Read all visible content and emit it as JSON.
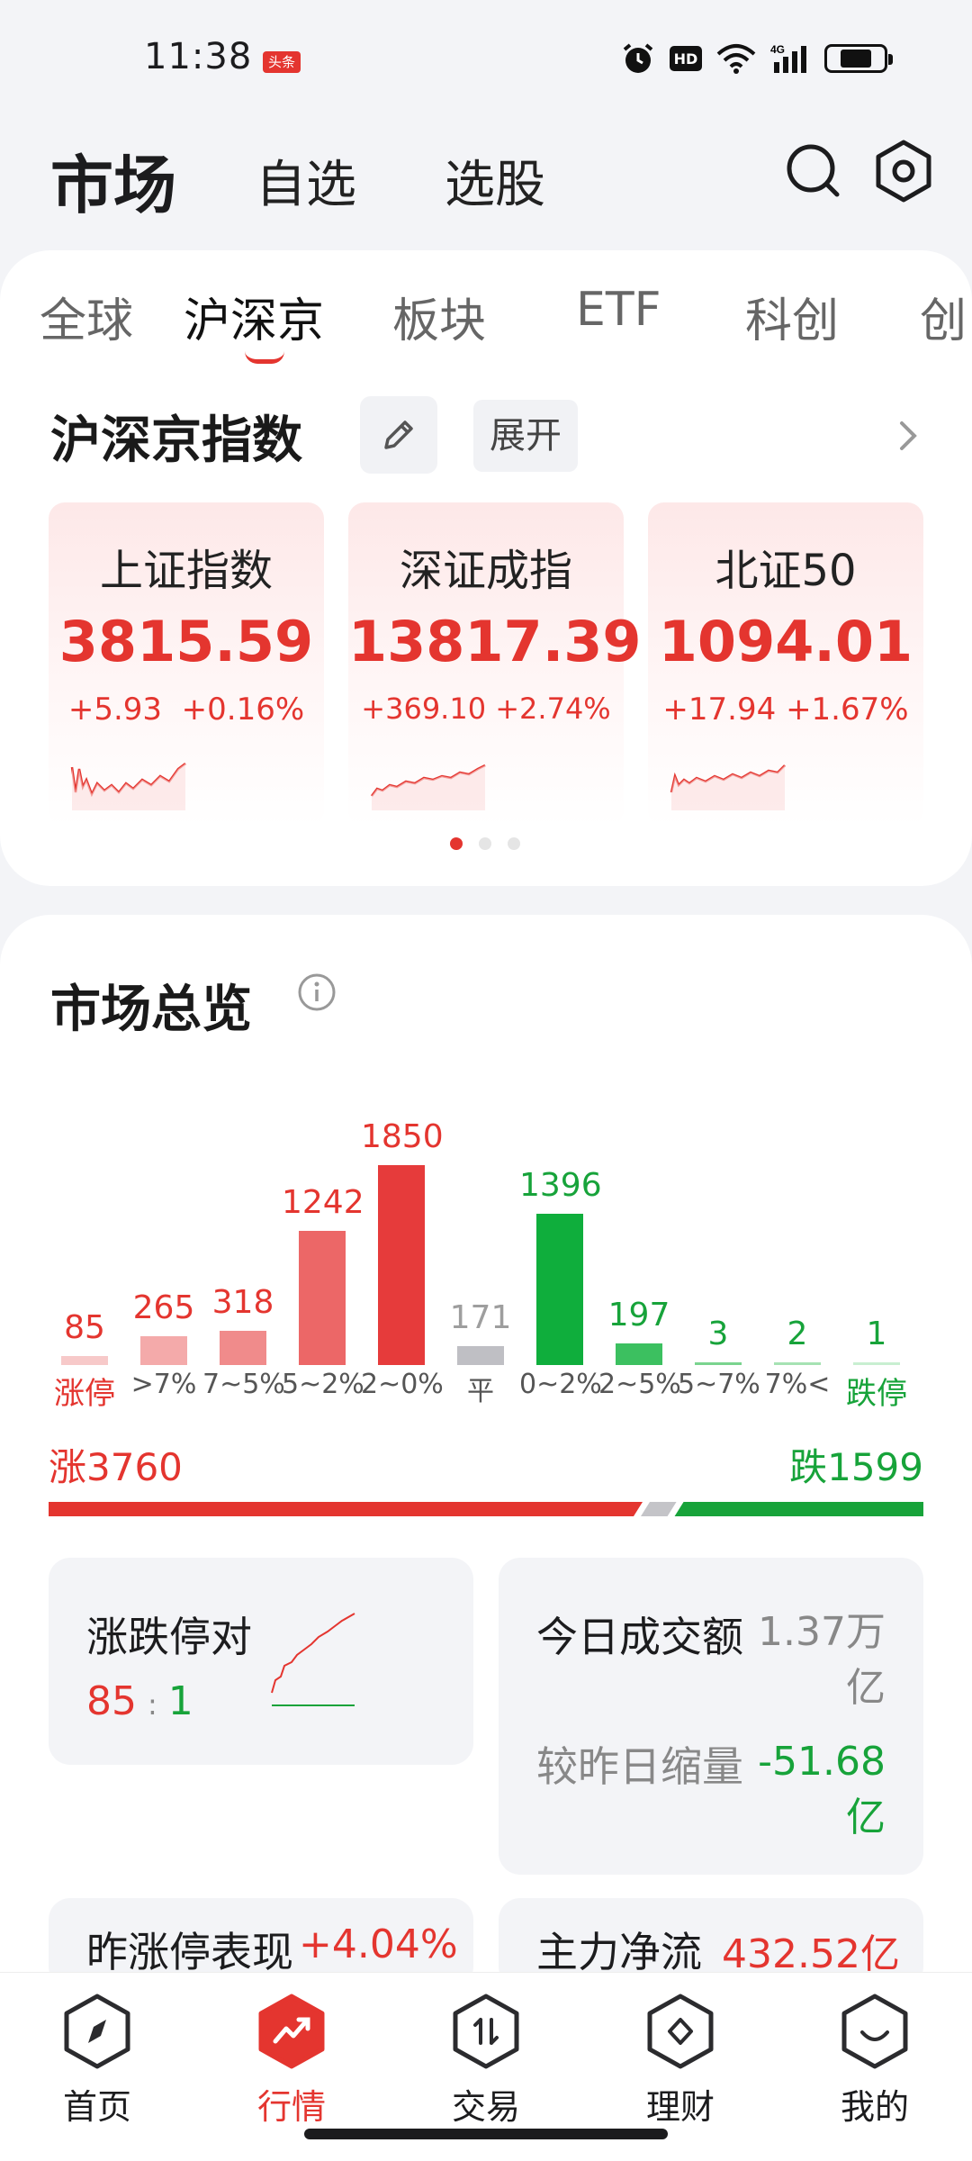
{
  "status_bar": {
    "time": "11:38",
    "badge": "头条",
    "hd": "HD",
    "net": "4G"
  },
  "header": {
    "title": "市场",
    "tab_watchlist": "自选",
    "tab_screener": "选股"
  },
  "market_tabs": [
    "全球",
    "沪深京",
    "板块",
    "ETF",
    "科创",
    "创"
  ],
  "indices_section": {
    "title": "沪深京指数",
    "expand": "展开",
    "cards": [
      {
        "name": "上证指数",
        "value": "3815.59",
        "change": "+5.93",
        "pct": "+0.16%"
      },
      {
        "name": "深证成指",
        "value": "13817.39",
        "change": "+369.10",
        "pct": "+2.74%"
      },
      {
        "name": "北证50",
        "value": "1094.01",
        "change": "+17.94",
        "pct": "+1.67%"
      }
    ]
  },
  "overview": {
    "title": "市场总览",
    "rise_label": "涨3760",
    "fall_label": "跌1599",
    "rise_count": 3760,
    "flat_count": 171,
    "fall_count": 1599,
    "limit_pair": {
      "title": "涨跌停对",
      "up": "85",
      "sep": ":",
      "down": "1"
    },
    "turnover": {
      "label": "今日成交额",
      "value": "1.37万亿",
      "compare_label": "较昨日缩量",
      "compare_value": "-51.68亿"
    },
    "prev_limit": {
      "label": "昨涨停表现",
      "value": "+4.04%"
    },
    "main_flow": {
      "label": "主力净流",
      "value": "432.52亿"
    }
  },
  "chart_data": {
    "type": "bar",
    "categories": [
      "涨停",
      ">7%",
      "7~5%",
      "5~2%",
      "2~0%",
      "平",
      "0~2%",
      "2~5%",
      "5~7%",
      "7%<",
      "跌停"
    ],
    "values": [
      85,
      265,
      318,
      1242,
      1850,
      171,
      1396,
      197,
      3,
      2,
      1
    ],
    "colors": [
      "#f7c9c9",
      "#f4aaaa",
      "#f08b8b",
      "#ec6767",
      "#e63b3b",
      "#bfbfc4",
      "#0fae3c",
      "#3cc060",
      "#7ad48f",
      "#a6e2b3",
      "#c8efd1"
    ],
    "value_colors": [
      "#e4352f",
      "#e4352f",
      "#e4352f",
      "#e4352f",
      "#e4352f",
      "#9e9e9e",
      "#17a33a",
      "#17a33a",
      "#17a33a",
      "#17a33a",
      "#17a33a"
    ],
    "label_colors": [
      "#e4352f",
      "#555555",
      "#555555",
      "#555555",
      "#555555",
      "#555555",
      "#555555",
      "#555555",
      "#555555",
      "#555555",
      "#17a33a"
    ],
    "ylim": [
      0,
      1850
    ]
  },
  "bottom_nav": [
    {
      "label": "首页",
      "icon": "compass-icon"
    },
    {
      "label": "行情",
      "icon": "market-trend-icon",
      "active": true
    },
    {
      "label": "交易",
      "icon": "trade-icon"
    },
    {
      "label": "理财",
      "icon": "wealth-icon"
    },
    {
      "label": "我的",
      "icon": "profile-icon"
    }
  ]
}
